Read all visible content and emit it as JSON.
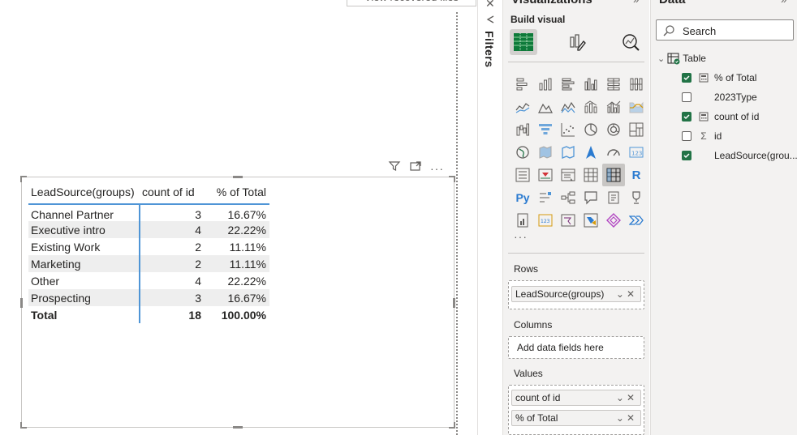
{
  "canvas": {
    "recover_label": "View recovered files"
  },
  "table_visual": {
    "columns": [
      "LeadSource(groups)",
      "count of id",
      "% of Total"
    ],
    "rows": [
      {
        "source": "Channel Partner",
        "count": "3",
        "pct": "16.67%"
      },
      {
        "source": "Executive intro",
        "count": "4",
        "pct": "22.22%"
      },
      {
        "source": "Existing Work",
        "count": "2",
        "pct": "11.11%"
      },
      {
        "source": "Marketing",
        "count": "2",
        "pct": "11.11%"
      },
      {
        "source": "Other",
        "count": "4",
        "pct": "22.22%"
      },
      {
        "source": "Prospecting",
        "count": "3",
        "pct": "16.67%"
      }
    ],
    "total": {
      "label": "Total",
      "count": "18",
      "pct": "100.00%"
    }
  },
  "filters": {
    "label": "Filters"
  },
  "visualizations": {
    "title": "Visualizations",
    "build_label": "Build visual",
    "more_label": "···",
    "rows_label": "Rows",
    "rows_field": "LeadSource(groups)",
    "columns_label": "Columns",
    "columns_placeholder": "Add data fields here",
    "values_label": "Values",
    "values_fields": [
      "count of id",
      "% of Total"
    ]
  },
  "data_pane": {
    "title": "Data",
    "search_placeholder": "Search",
    "table_name": "Table",
    "fields": [
      {
        "name": "% of Total",
        "checked": true,
        "type": "calc"
      },
      {
        "name": "2023Type",
        "checked": false,
        "type": "none"
      },
      {
        "name": "count of id",
        "checked": true,
        "type": "calc"
      },
      {
        "name": "id",
        "checked": false,
        "type": "sum"
      },
      {
        "name": "LeadSource(grou...",
        "checked": true,
        "type": "none"
      }
    ]
  },
  "colors": {
    "accent": "#4f95d6",
    "check": "#217346",
    "pane_bg": "#f3f2f1"
  }
}
